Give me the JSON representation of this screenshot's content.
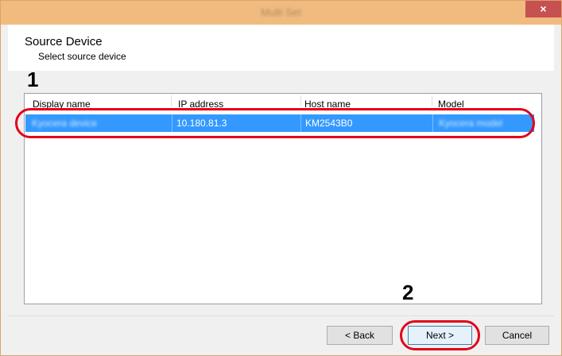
{
  "window": {
    "title": "Multi Set",
    "close_glyph": "×"
  },
  "header": {
    "title": "Source Device",
    "subtitle": "Select source device"
  },
  "annotations": {
    "step1": "1",
    "step2": "2",
    "ring_color": "#e2001a"
  },
  "table": {
    "columns": [
      "Display name",
      "IP address",
      "Host name",
      "Model"
    ],
    "rows": [
      {
        "display_name": "Kyocera device",
        "ip_address": "10.180.81.3",
        "host_name": "KM2543B0",
        "model": "Kyocera model",
        "selected": true
      }
    ]
  },
  "buttons": {
    "back": "< Back",
    "next": "Next >",
    "cancel": "Cancel"
  },
  "colors": {
    "titlebar": "#f1bb7f",
    "close": "#c75050",
    "selection": "#3399ff"
  },
  "icons": {
    "close": "close-icon"
  }
}
